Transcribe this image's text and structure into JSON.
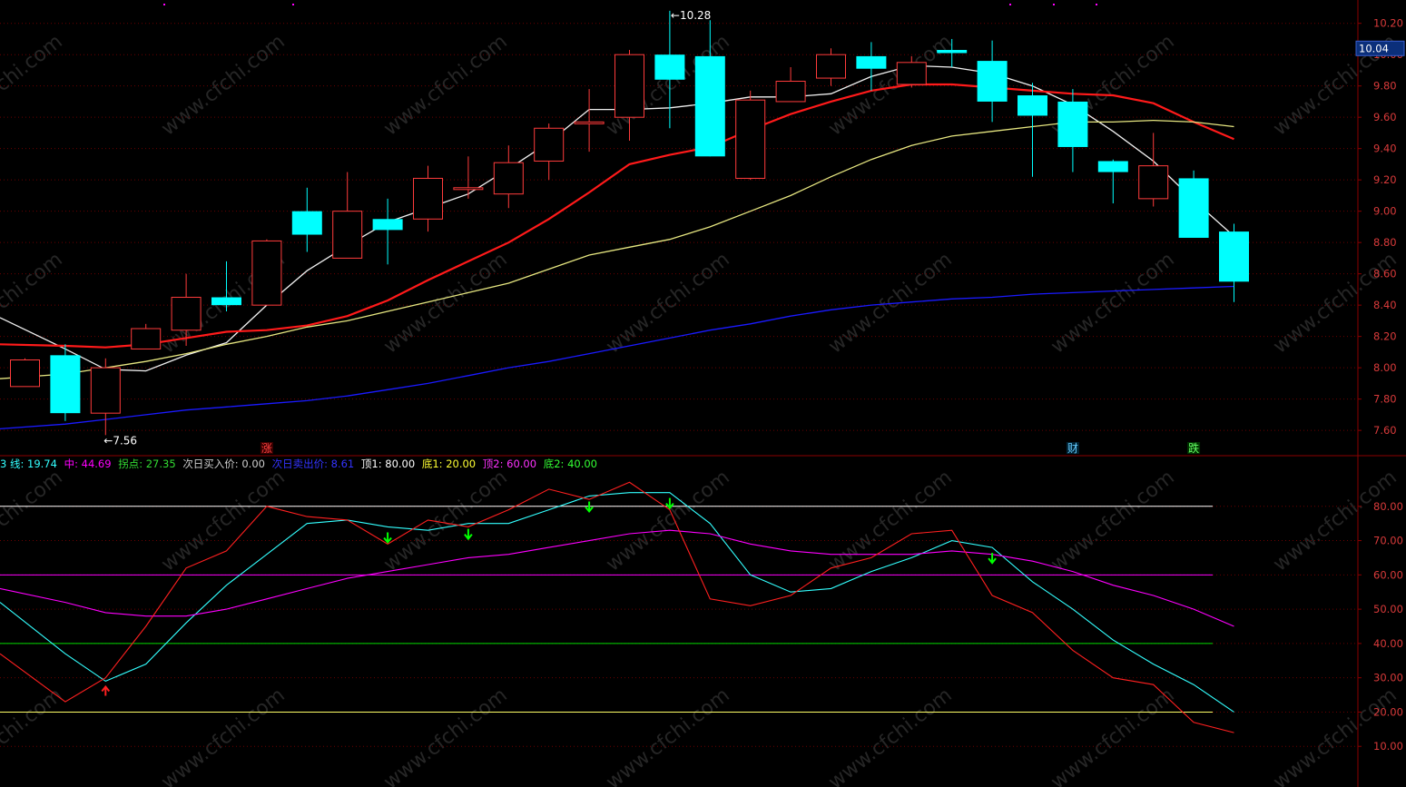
{
  "colors": {
    "background": "#000000",
    "grid": "#6a0000",
    "frame": "#8b0000",
    "up": "#ff3b3b",
    "down": "#00ffff",
    "ma_white": "#f0f0f0",
    "ma_red": "#ff1a1a",
    "ma_yellow": "#e6e680",
    "ma_blue": "#1a1aff",
    "axis_text": "#d83a3a",
    "osc_white": "#ffffff",
    "osc_magenta": "#ff00ff",
    "osc_green": "#00dd00",
    "osc_yellow": "#ffff66",
    "osc_cyan": "#33ffff",
    "osc_red": "#ff2020",
    "arrow_green": "#00ff00",
    "arrow_red": "#ff2020"
  },
  "price_panel": {
    "ylim": [
      7.45,
      10.32
    ],
    "y_ticks": [
      "7.60",
      "7.80",
      "8.00",
      "8.20",
      "8.40",
      "8.60",
      "8.80",
      "9.00",
      "9.20",
      "9.40",
      "9.60",
      "9.80",
      "10.00",
      "10.20"
    ],
    "current_price": "10.04",
    "high_label": "10.28",
    "low_label": "7.56",
    "markers": [
      {
        "label": "涨",
        "candle_index": 6,
        "color": "#ff4040",
        "bg": "#3a0000"
      },
      {
        "label": "财",
        "candle_index": 26,
        "color": "#66ccff",
        "bg": "#002233"
      },
      {
        "label": "跌",
        "candle_index": 29,
        "color": "#66ff66",
        "bg": "#003300"
      }
    ]
  },
  "chart_data": [
    {
      "type": "candlestick",
      "candles": [
        {
          "o": 7.88,
          "h": 8.06,
          "l": 7.88,
          "c": 8.05
        },
        {
          "o": 8.08,
          "h": 8.15,
          "l": 7.66,
          "c": 7.71
        },
        {
          "o": 7.71,
          "h": 8.06,
          "l": 7.57,
          "c": 8.0
        },
        {
          "o": 8.12,
          "h": 8.28,
          "l": 8.12,
          "c": 8.25
        },
        {
          "o": 8.24,
          "h": 8.6,
          "l": 8.14,
          "c": 8.45
        },
        {
          "o": 8.45,
          "h": 8.68,
          "l": 8.36,
          "c": 8.4
        },
        {
          "o": 8.4,
          "h": 8.82,
          "l": 8.4,
          "c": 8.81
        },
        {
          "o": 9.0,
          "h": 9.15,
          "l": 8.74,
          "c": 8.85
        },
        {
          "o": 8.7,
          "h": 9.25,
          "l": 8.7,
          "c": 9.0
        },
        {
          "o": 8.95,
          "h": 9.08,
          "l": 8.66,
          "c": 8.88
        },
        {
          "o": 8.95,
          "h": 9.29,
          "l": 8.87,
          "c": 9.21
        },
        {
          "o": 9.15,
          "h": 9.35,
          "l": 9.08,
          "c": 9.15
        },
        {
          "o": 9.11,
          "h": 9.42,
          "l": 9.02,
          "c": 9.31
        },
        {
          "o": 9.32,
          "h": 9.56,
          "l": 9.2,
          "c": 9.53
        },
        {
          "o": 9.57,
          "h": 9.78,
          "l": 9.38,
          "c": 9.57
        },
        {
          "o": 9.6,
          "h": 10.03,
          "l": 9.45,
          "c": 10.0
        },
        {
          "o": 10.0,
          "h": 10.28,
          "l": 9.53,
          "c": 9.84
        },
        {
          "o": 9.99,
          "h": 10.22,
          "l": 9.35,
          "c": 9.35
        },
        {
          "o": 9.21,
          "h": 9.77,
          "l": 9.2,
          "c": 9.71
        },
        {
          "o": 9.7,
          "h": 9.92,
          "l": 9.7,
          "c": 9.83
        },
        {
          "o": 9.85,
          "h": 10.04,
          "l": 9.8,
          "c": 10.0
        },
        {
          "o": 9.99,
          "h": 10.08,
          "l": 9.77,
          "c": 9.91
        },
        {
          "o": 9.81,
          "h": 9.99,
          "l": 9.79,
          "c": 9.95
        },
        {
          "o": 10.03,
          "h": 10.1,
          "l": 9.92,
          "c": 10.01
        },
        {
          "o": 9.96,
          "h": 10.09,
          "l": 9.57,
          "c": 9.7
        },
        {
          "o": 9.74,
          "h": 9.82,
          "l": 9.22,
          "c": 9.61
        },
        {
          "o": 9.7,
          "h": 9.78,
          "l": 9.25,
          "c": 9.41
        },
        {
          "o": 9.32,
          "h": 9.33,
          "l": 9.05,
          "c": 9.25
        },
        {
          "o": 9.08,
          "h": 9.5,
          "l": 9.03,
          "c": 9.29
        },
        {
          "o": 9.21,
          "h": 9.26,
          "l": 8.84,
          "c": 8.83
        },
        {
          "o": 8.87,
          "h": 8.92,
          "l": 8.42,
          "c": 8.55
        }
      ]
    },
    {
      "type": "line",
      "series": [
        {
          "color_key": "ma_white",
          "width": 1.3,
          "values": [
            8.32,
            8.12,
            7.99,
            7.98,
            8.08,
            8.16,
            8.4,
            8.62,
            8.78,
            8.93,
            9.02,
            9.11,
            9.27,
            9.44,
            9.65,
            9.65,
            9.66,
            9.69,
            9.73,
            9.73,
            9.75,
            9.86,
            9.93,
            9.92,
            9.88,
            9.8,
            9.68,
            9.51,
            9.32,
            9.07,
            8.84
          ]
        },
        {
          "color_key": "ma_red",
          "width": 2.2,
          "values": [
            8.15,
            8.14,
            8.13,
            8.15,
            8.19,
            8.23,
            8.24,
            8.27,
            8.33,
            8.43,
            8.56,
            8.68,
            8.8,
            8.95,
            9.12,
            9.3,
            9.36,
            9.41,
            9.52,
            9.62,
            9.7,
            9.77,
            9.81,
            9.81,
            9.79,
            9.77,
            9.75,
            9.74,
            9.69,
            9.57,
            9.46
          ]
        },
        {
          "color_key": "ma_yellow",
          "width": 1.3,
          "values": [
            7.93,
            7.96,
            8.0,
            8.04,
            8.09,
            8.15,
            8.2,
            8.26,
            8.3,
            8.36,
            8.42,
            8.48,
            8.54,
            8.63,
            8.72,
            8.77,
            8.82,
            8.9,
            9.0,
            9.1,
            9.22,
            9.33,
            9.42,
            9.48,
            9.51,
            9.54,
            9.57,
            9.57,
            9.58,
            9.57,
            9.54
          ]
        },
        {
          "color_key": "ma_blue",
          "width": 1.3,
          "values": [
            7.61,
            7.64,
            7.67,
            7.7,
            7.73,
            7.75,
            7.77,
            7.79,
            7.82,
            7.86,
            7.9,
            7.95,
            8.0,
            8.04,
            8.09,
            8.14,
            8.19,
            8.24,
            8.28,
            8.33,
            8.37,
            8.4,
            8.42,
            8.44,
            8.45,
            8.47,
            8.48,
            8.49,
            8.5,
            8.51,
            8.52
          ]
        }
      ]
    },
    {
      "type": "line",
      "ylim": [
        0,
        90
      ],
      "y_ticks": [
        "10.00",
        "20.00",
        "30.00",
        "40.00",
        "50.00",
        "60.00",
        "70.00",
        "80.00"
      ],
      "hlines": [
        {
          "value": 80,
          "color_key": "osc_white"
        },
        {
          "value": 60,
          "color_key": "osc_magenta"
        },
        {
          "value": 40,
          "color_key": "osc_green"
        },
        {
          "value": 20,
          "color_key": "osc_yellow"
        }
      ],
      "series": [
        {
          "color_key": "osc_cyan",
          "values": [
            52,
            37,
            29,
            34,
            46,
            57,
            66,
            75,
            76,
            74,
            73,
            75,
            75,
            79,
            83,
            84,
            84,
            75,
            60,
            55,
            56,
            61,
            65,
            70,
            68,
            58,
            50,
            41,
            34,
            28,
            20
          ]
        },
        {
          "color_key": "osc_magenta",
          "values": [
            56,
            52,
            49,
            48,
            48,
            50,
            53,
            56,
            59,
            61,
            63,
            65,
            66,
            68,
            70,
            72,
            73,
            72,
            69,
            67,
            66,
            66,
            66,
            67,
            66,
            64,
            61,
            57,
            54,
            50,
            45
          ]
        },
        {
          "color_key": "osc_red",
          "values": [
            37,
            23,
            30,
            45,
            62,
            67,
            80,
            77,
            76,
            69,
            76,
            74,
            79,
            85,
            82,
            87,
            79,
            53,
            51,
            54,
            62,
            65,
            72,
            73,
            54,
            49,
            38,
            30,
            28,
            17,
            14
          ]
        }
      ],
      "arrows": [
        {
          "index": 2,
          "dir": "up"
        },
        {
          "index": 9,
          "dir": "down"
        },
        {
          "index": 11,
          "dir": "down"
        },
        {
          "index": 14,
          "dir": "down"
        },
        {
          "index": 16,
          "dir": "down"
        },
        {
          "index": 24,
          "dir": "down"
        }
      ]
    }
  ],
  "legend": [
    {
      "text": "3 线: 19.74",
      "color": "#33ffff"
    },
    {
      "text": "中: 44.69",
      "color": "#ff00ff"
    },
    {
      "text": "拐点: 27.35",
      "color": "#33dd33"
    },
    {
      "text": "次日买入价: 0.00",
      "color": "#cccccc"
    },
    {
      "text": "次日卖出价: 8.61",
      "color": "#3333ff"
    },
    {
      "text": "顶1: 80.00",
      "color": "#ffffff"
    },
    {
      "text": "底1: 20.00",
      "color": "#ffff33"
    },
    {
      "text": "顶2: 60.00",
      "color": "#ff33ff"
    },
    {
      "text": "底2: 40.00",
      "color": "#33ff33"
    }
  ],
  "watermark": "www.cfchi.com"
}
